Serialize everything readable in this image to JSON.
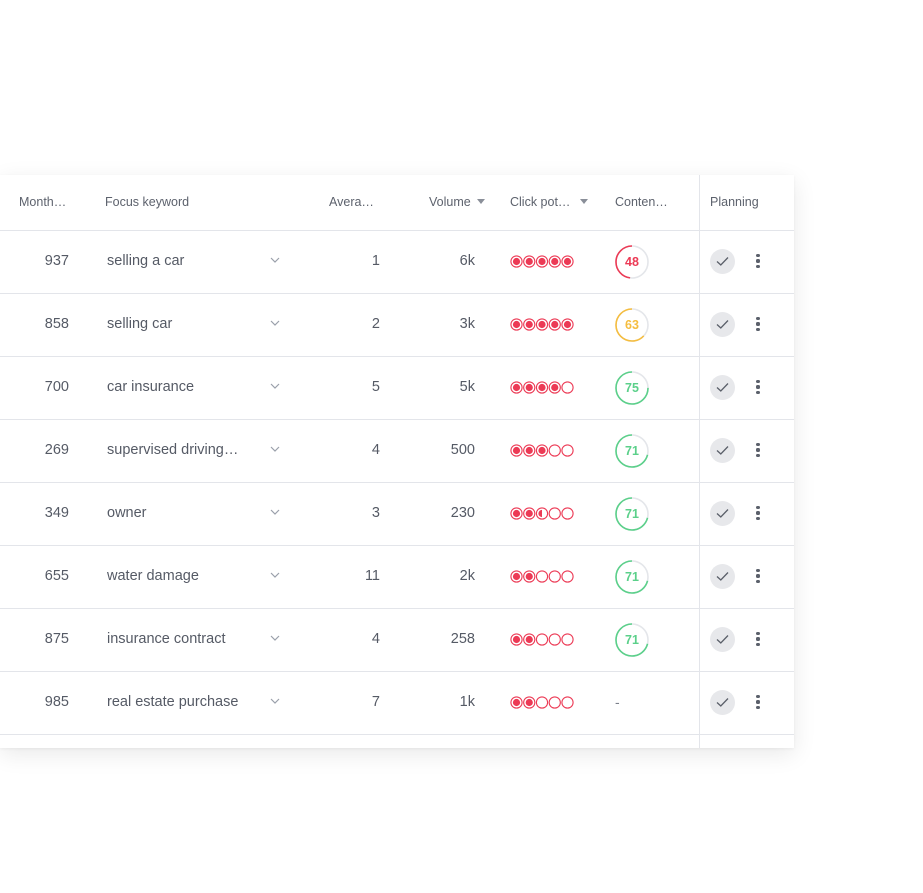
{
  "columns": {
    "monthly": "Month…",
    "focus_keyword": "Focus keyword",
    "average": "Avera…",
    "volume": "Volume",
    "click_potential": "Click pot…",
    "content": "Conten…",
    "planning": "Planning"
  },
  "colors": {
    "red": "#ec3a55",
    "yellow": "#f5bd3f",
    "green": "#5bd08a",
    "border": "#e3e5ea"
  },
  "rows": [
    {
      "monthly": "937",
      "keyword": "selling a car",
      "average": "1",
      "volume": "6k",
      "click_potential": 5,
      "content_score": "48",
      "content_status": "red",
      "content_fill": 0.48
    },
    {
      "monthly": "858",
      "keyword": "selling car",
      "average": "2",
      "volume": "3k",
      "click_potential": 5,
      "content_score": "63",
      "content_status": "yellow",
      "content_fill": 0.63
    },
    {
      "monthly": "700",
      "keyword": "car insurance",
      "average": "5",
      "volume": "5k",
      "click_potential": 4,
      "content_score": "75",
      "content_status": "green",
      "content_fill": 0.75
    },
    {
      "monthly": "269",
      "keyword": "supervised driving…",
      "average": "4",
      "volume": "500",
      "click_potential": 3,
      "content_score": "71",
      "content_status": "green",
      "content_fill": 0.71
    },
    {
      "monthly": "349",
      "keyword": "owner",
      "average": "3",
      "volume": "230",
      "click_potential": 2.5,
      "content_score": "71",
      "content_status": "green",
      "content_fill": 0.71
    },
    {
      "monthly": "655",
      "keyword": "water damage",
      "average": "11",
      "volume": "2k",
      "click_potential": 2,
      "content_score": "71",
      "content_status": "green",
      "content_fill": 0.71
    },
    {
      "monthly": "875",
      "keyword": "insurance contract",
      "average": "4",
      "volume": "258",
      "click_potential": 2,
      "content_score": "71",
      "content_status": "green",
      "content_fill": 0.71
    },
    {
      "monthly": "985",
      "keyword": "real estate purchase",
      "average": "7",
      "volume": "1k",
      "click_potential": 2,
      "content_score": "-",
      "content_status": "none",
      "content_fill": 0
    }
  ]
}
